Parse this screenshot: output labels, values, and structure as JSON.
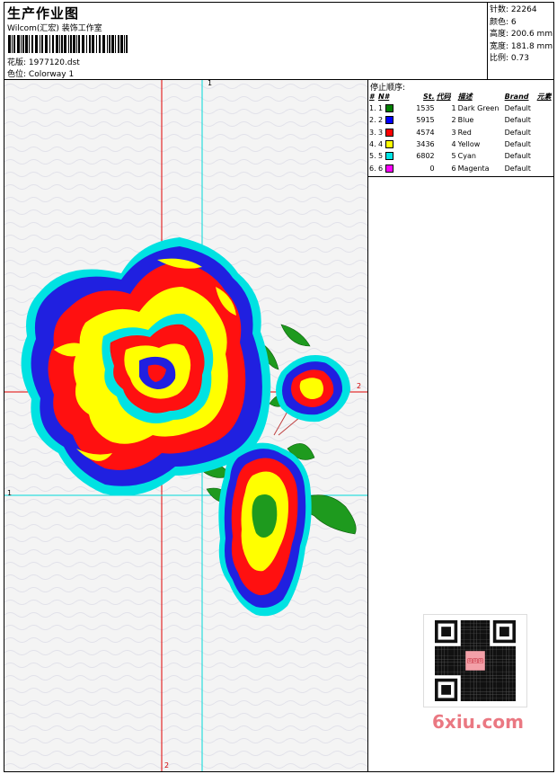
{
  "header": {
    "title": "生产作业图",
    "subtitle": "Wilcom(汇宏) 装饰工作室",
    "design_label": "花版:",
    "design_value": "1977120.dst",
    "colorway_label": "色位:",
    "colorway_value": "Colorway 1"
  },
  "stats": [
    {
      "label": "针数:",
      "value": "22264"
    },
    {
      "label": "颜色:",
      "value": "6"
    },
    {
      "label": "高度:",
      "value": "200.6 mm"
    },
    {
      "label": "宽度:",
      "value": "181.8 mm"
    },
    {
      "label": "比例:",
      "value": "0.73"
    }
  ],
  "stop_sequence": {
    "title": "停止顺序:",
    "columns": [
      "#",
      "N#",
      "St.",
      "代码",
      "描述",
      "Brand",
      "元素"
    ],
    "rows": [
      {
        "idx": "1.",
        "n": "1",
        "color": "#008000",
        "st": "1535",
        "code": "1",
        "desc": "Dark Green",
        "brand": "Default"
      },
      {
        "idx": "2.",
        "n": "2",
        "color": "#0000ff",
        "st": "5915",
        "code": "2",
        "desc": "Blue",
        "brand": "Default"
      },
      {
        "idx": "3.",
        "n": "3",
        "color": "#ff0000",
        "st": "4574",
        "code": "3",
        "desc": "Red",
        "brand": "Default"
      },
      {
        "idx": "4.",
        "n": "4",
        "color": "#ffff00",
        "st": "3436",
        "code": "4",
        "desc": "Yellow",
        "brand": "Default"
      },
      {
        "idx": "5.",
        "n": "5",
        "color": "#00e5e5",
        "st": "6802",
        "code": "5",
        "desc": "Cyan",
        "brand": "Default"
      },
      {
        "idx": "6.",
        "n": "6",
        "color": "#ff00ff",
        "st": "0",
        "code": "6",
        "desc": "Magenta",
        "brand": "Default"
      }
    ]
  },
  "axis_labels": {
    "top_1": "1",
    "right_2": "2",
    "left_1": "1",
    "bottom_2": "2"
  },
  "watermark": "6xiu.com",
  "qr_stamp_text": "回回回"
}
